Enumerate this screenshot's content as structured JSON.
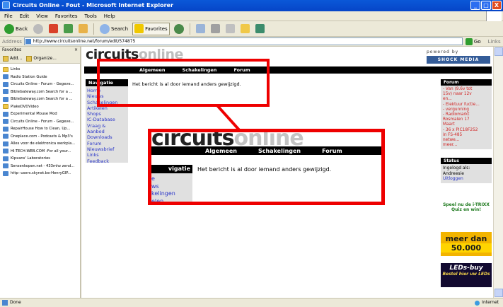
{
  "window": {
    "title": "Circuits Online - Fout - Microsoft Internet Explorer",
    "min": "_",
    "max": "□",
    "close": "X"
  },
  "menu": [
    "File",
    "Edit",
    "View",
    "Favorites",
    "Tools",
    "Help"
  ],
  "toolbar": {
    "back": "Back",
    "search": "Search",
    "favorites": "Favorites"
  },
  "address": {
    "label": "Address",
    "url": "http://www.circuitsonline.net/forum/edit/574875",
    "go": "Go",
    "links": "Links"
  },
  "favorites": {
    "title": "Favorites",
    "add": "Add...",
    "organize": "Organize...",
    "items": [
      {
        "label": "Links",
        "folder": true
      },
      {
        "label": "Radio Station Guide",
        "folder": false
      },
      {
        "label": "Circuits Online - Forum - Gegeve...",
        "folder": false
      },
      {
        "label": "BibleGateway.com Search for a ...",
        "folder": false
      },
      {
        "label": "BibleGateway.com Search for a ...",
        "folder": false
      },
      {
        "label": "PlakeDVDVideo",
        "folder": true
      },
      {
        "label": "Experimental Mouse Mod",
        "folder": false
      },
      {
        "label": "Circuits Online - Forum - Gegeve...",
        "folder": false
      },
      {
        "label": "RepairHouse How to Clean, Up...",
        "folder": false
      },
      {
        "label": "Oneplace.com - Podcasts & Mp3's",
        "folder": false
      },
      {
        "label": "Alles voor de elektronica werkpla...",
        "folder": false
      },
      {
        "label": "HI-TECH-WEB.COM -For all your...",
        "folder": false
      },
      {
        "label": "Kipxans' Laboratories",
        "folder": false
      },
      {
        "label": "Sensenkopen.net - 433mhz zend...",
        "folder": false
      },
      {
        "label": "http--users.skynet.be-HenryGIP...",
        "folder": false
      }
    ]
  },
  "site": {
    "logo_a": "circuits",
    "logo_b": "online",
    "powered": "powered by",
    "shock": "SHOCK MEDIA",
    "nav": [
      "Algemeen",
      "Schakelingen",
      "Forum"
    ],
    "message": "Het bericht is al door iemand anders gewijzigd.",
    "navigatie_title": "Navigatie",
    "navigatie": [
      "Home",
      "Nieuws",
      "Schakelingen",
      "Artikelen",
      "Shops",
      "IC-Database",
      "Vraag &",
      "Aanbod",
      "Downloads",
      "Forum",
      "Nieuwsbrief",
      "Links",
      "Feedback"
    ],
    "forum_title": "Forum",
    "forum_items": [
      "- Van (9.6v tot",
      "15v) naar 12v",
      "en...",
      "- Elektuur fuctie...",
      "- vergunning",
      "- Radiomarkt",
      "Rosmalen 17",
      "Maart",
      "- 36 x PIC18F252",
      "in FS-485",
      "netwe...",
      "meer..."
    ],
    "status_title": "Status",
    "status_label": "Ingelogd als:",
    "status_user": "Andreesie",
    "status_logout": "Uitloggen",
    "promo": "Speel nu de i-TRIXX Quiz en win!",
    "ad1_l1": "meer dan",
    "ad1_l2": "50.000",
    "ad2_l1": "LEDs-buy",
    "ad2_l2": "Bestel hier uw LEDs"
  },
  "zoom": {
    "logo_a": "circuits",
    "logo_b": "online",
    "nav": [
      "Algemeen",
      "Schakelingen",
      "Forum"
    ],
    "message": "Het bericht is al door iemand anders gewijzigd.",
    "box_title": "vigatie",
    "items": [
      "e",
      "ws",
      "kelingen",
      "elen"
    ]
  },
  "statusbar": {
    "left": "Done",
    "zone": "Internet"
  },
  "colors": {
    "highlight": "#ee0000",
    "navbar": "#000000",
    "link": "#2a36c8",
    "forum_link": "#d12222"
  }
}
